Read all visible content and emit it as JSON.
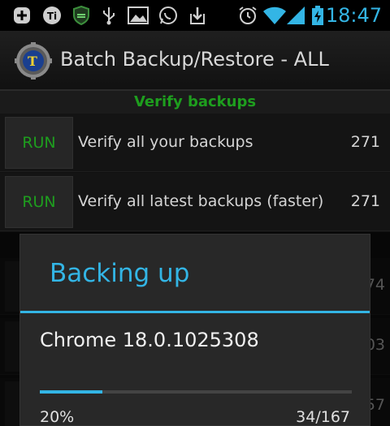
{
  "status_bar": {
    "time": "18:47",
    "left_icons": [
      "plus-box-icon",
      "titanium-icon",
      "shield-icon",
      "usb-icon",
      "image-icon",
      "whatsapp-icon",
      "download-icon"
    ],
    "right_icons": [
      "alarm-icon",
      "wifi-icon",
      "signal-icon",
      "battery-charging-icon"
    ]
  },
  "action_bar": {
    "title": "Batch Backup/Restore - ALL"
  },
  "section": {
    "title": "Verify backups"
  },
  "rows": [
    {
      "button_label": "RUN",
      "label": "Verify all your backups",
      "count": "271"
    },
    {
      "button_label": "RUN",
      "label": "Verify all latest backups (faster)",
      "count": "271"
    }
  ],
  "background_rows": [
    {
      "partial_number": "74"
    },
    {
      "partial_number": "03"
    },
    {
      "partial_number": "57"
    }
  ],
  "dialog": {
    "title": "Backing up",
    "message": "Chrome 18.0.1025308",
    "progress_percent_label": "20%",
    "progress_count_label": "34/167",
    "progress_fraction": 0.2
  },
  "colors": {
    "accent_blue": "#33b5e5",
    "run_green": "#1e9e1e"
  }
}
